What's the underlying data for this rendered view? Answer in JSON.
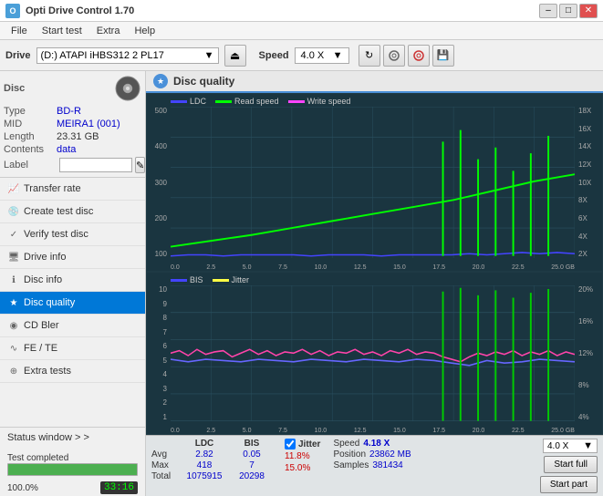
{
  "titlebar": {
    "title": "Opti Drive Control 1.70",
    "min": "–",
    "max": "□",
    "close": "✕"
  },
  "menu": {
    "items": [
      "File",
      "Start test",
      "Extra",
      "Help"
    ]
  },
  "drivebar": {
    "label": "Drive",
    "drive_value": "(D:) ATAPI iHBS312  2 PL17",
    "speed_label": "Speed",
    "speed_value": "4.0 X"
  },
  "disc": {
    "type_label": "Type",
    "type_value": "BD-R",
    "mid_label": "MID",
    "mid_value": "MEIRA1 (001)",
    "length_label": "Length",
    "length_value": "23.31 GB",
    "contents_label": "Contents",
    "contents_value": "data",
    "label_label": "Label"
  },
  "nav": {
    "items": [
      {
        "id": "transfer-rate",
        "label": "Transfer rate"
      },
      {
        "id": "create-test-disc",
        "label": "Create test disc"
      },
      {
        "id": "verify-test-disc",
        "label": "Verify test disc"
      },
      {
        "id": "drive-info",
        "label": "Drive info"
      },
      {
        "id": "disc-info",
        "label": "Disc info"
      },
      {
        "id": "disc-quality",
        "label": "Disc quality",
        "active": true
      },
      {
        "id": "cd-bler",
        "label": "CD Bler"
      },
      {
        "id": "fe-te",
        "label": "FE / TE"
      },
      {
        "id": "extra-tests",
        "label": "Extra tests"
      }
    ]
  },
  "status": {
    "window_btn": "Status window > >",
    "progress": 100,
    "status_text": "Test completed",
    "time": "33:16"
  },
  "quality": {
    "title": "Disc quality",
    "legend_upper": [
      {
        "color": "#0000ff",
        "label": "LDC"
      },
      {
        "color": "#00ff00",
        "label": "Read speed"
      },
      {
        "color": "#ff00ff",
        "label": "Write speed"
      }
    ],
    "legend_lower": [
      {
        "color": "#0000ff",
        "label": "BIS"
      },
      {
        "color": "#ffff00",
        "label": "Jitter"
      }
    ],
    "upper_y_right": [
      "18X",
      "16X",
      "14X",
      "12X",
      "10X",
      "8X",
      "6X",
      "4X",
      "2X"
    ],
    "upper_y_left": [
      "500",
      "400",
      "300",
      "200",
      "100"
    ],
    "lower_y_right": [
      "20%",
      "16%",
      "12%",
      "8%",
      "4%"
    ],
    "lower_y_left": [
      "10",
      "9",
      "8",
      "7",
      "6",
      "5",
      "4",
      "3",
      "2",
      "1"
    ],
    "x_labels": [
      "0.0",
      "2.5",
      "5.0",
      "7.5",
      "10.0",
      "12.5",
      "15.0",
      "17.5",
      "20.0",
      "22.5",
      "25.0 GB"
    ]
  },
  "stats": {
    "ldc_label": "LDC",
    "bis_label": "BIS",
    "jitter_label": "Jitter",
    "speed_label": "Speed",
    "speed_val": "4.18 X",
    "speed_dropdown": "4.0 X",
    "avg_label": "Avg",
    "avg_ldc": "2.82",
    "avg_bis": "0.05",
    "avg_jitter": "11.8%",
    "max_label": "Max",
    "max_ldc": "418",
    "max_bis": "7",
    "max_jitter": "15.0%",
    "total_label": "Total",
    "total_ldc": "1075915",
    "total_bis": "20298",
    "position_label": "Position",
    "position_val": "23862 MB",
    "samples_label": "Samples",
    "samples_val": "381434",
    "start_full": "Start full",
    "start_part": "Start part"
  }
}
